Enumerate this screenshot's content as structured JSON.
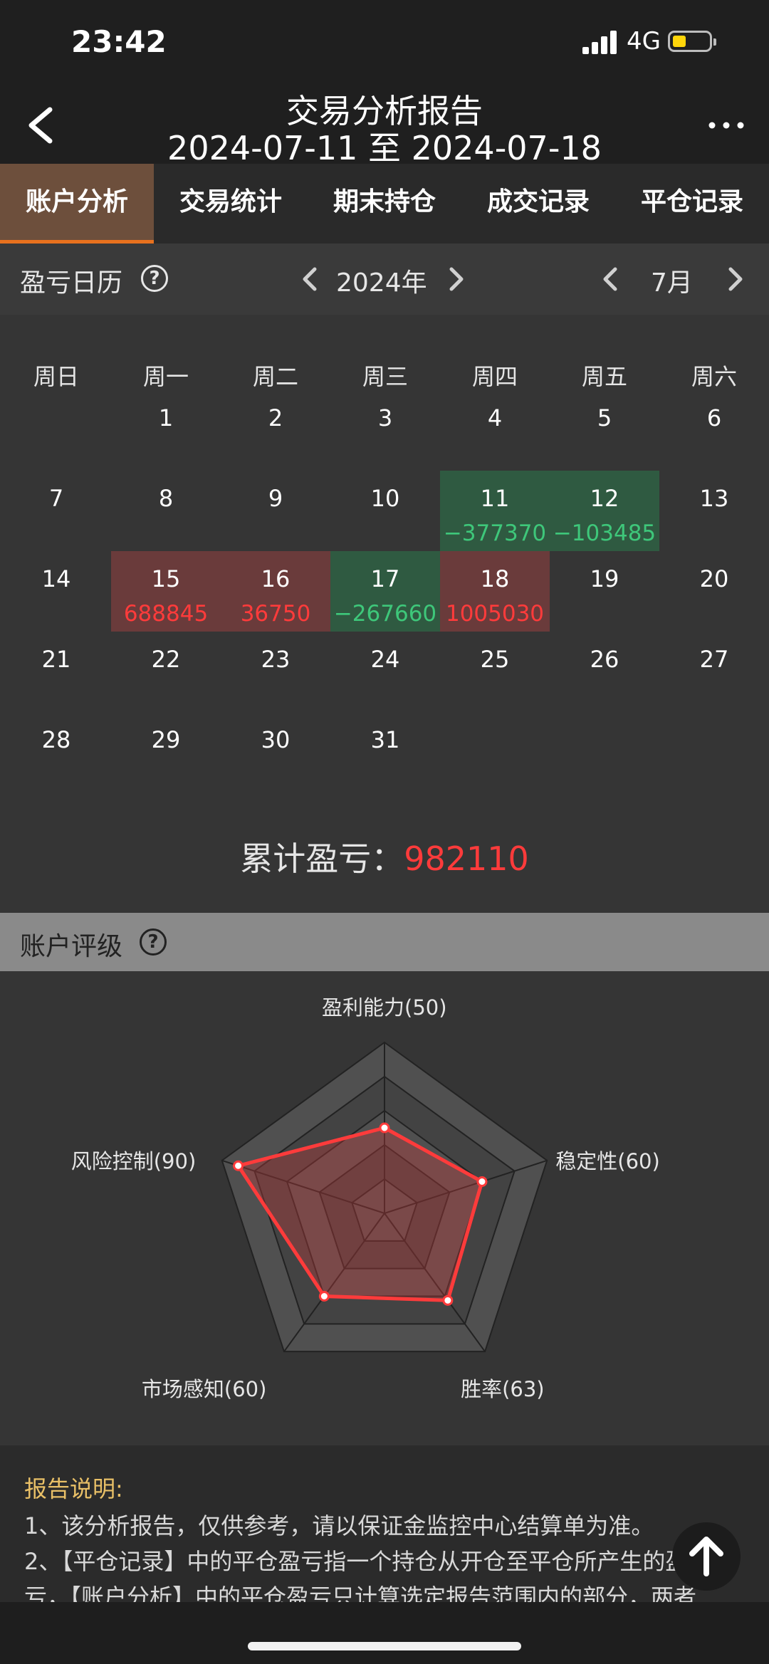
{
  "status": {
    "time": "23:42",
    "network": "4G",
    "battery_level": 0.35,
    "battery_color": "#ffd60a"
  },
  "nav": {
    "title": "交易分析报告",
    "subtitle": "2024-07-11 至 2024-07-18",
    "back_icon": "chevron-left-icon",
    "more_icon": "more-horizontal-icon"
  },
  "tabs": [
    {
      "label": "账户分析",
      "active": true
    },
    {
      "label": "交易统计",
      "active": false
    },
    {
      "label": "期末持仓",
      "active": false
    },
    {
      "label": "成交记录",
      "active": false
    },
    {
      "label": "平仓记录",
      "active": false
    }
  ],
  "calendar": {
    "title": "盈亏日历",
    "year": "2024年",
    "month": "7月",
    "weekdays": [
      "周日",
      "周一",
      "周二",
      "周三",
      "周四",
      "周五",
      "周六"
    ],
    "first_weekday": 1,
    "days_in_month": 31,
    "pnl": {
      "11": {
        "value": "−377370",
        "type": "loss"
      },
      "12": {
        "value": "−103485",
        "type": "loss"
      },
      "15": {
        "value": "688845",
        "type": "win"
      },
      "16": {
        "value": "36750",
        "type": "win"
      },
      "17": {
        "value": "−267660",
        "type": "loss"
      },
      "18": {
        "value": "1005030",
        "type": "win"
      }
    },
    "colors": {
      "win": "#ff3b3b",
      "loss": "#3ec77a"
    }
  },
  "total": {
    "label": "累计盈亏：",
    "value": "982110"
  },
  "rating": {
    "title": "账户评级",
    "axes": [
      {
        "label": "盈利能力(50)",
        "value": 50
      },
      {
        "label": "稳定性(60)",
        "value": 60
      },
      {
        "label": "胜率(63)",
        "value": 63
      },
      {
        "label": "市场感知(60)",
        "value": 60
      },
      {
        "label": "风险控制(90)",
        "value": 90
      }
    ],
    "max": 100,
    "line_color": "#ff3b3b"
  },
  "notes": {
    "title": "报告说明:",
    "lines": [
      "1、该分析报告，仅供参考，请以保证金监控中心结算单为准。",
      "2、【平仓记录】中的平仓盈亏指一个持仓从开仓至平仓所产生的盈",
      "亏，【账户分析】中的平仓盈亏只计算选定报告范围内的部分，两者"
    ]
  },
  "scroll_top_icon": "arrow-up-icon"
}
